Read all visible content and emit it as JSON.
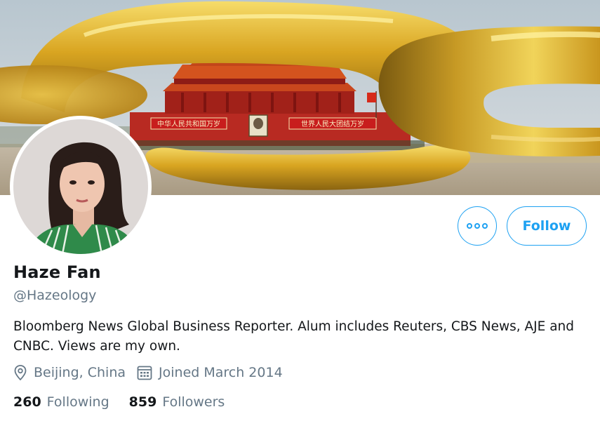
{
  "banner": {
    "sign_left": "中华人民共和国万岁",
    "sign_right": "世界人民大团结万岁"
  },
  "profile": {
    "display_name": "Haze Fan",
    "handle": "@Hazeology",
    "bio": "Bloomberg News Global Business Reporter. Alum includes Reuters, CBS News, AJE and CNBC. Views are my own.",
    "location": "Beijing, China",
    "joined": "Joined March 2014"
  },
  "actions": {
    "more_icon": "more-options-icon",
    "follow_label": "Follow"
  },
  "stats": {
    "following_count": "260",
    "following_label": "Following",
    "followers_count": "859",
    "followers_label": "Followers"
  },
  "colors": {
    "accent": "#1da1f2",
    "text_primary": "#14171a",
    "text_secondary": "#657786"
  }
}
